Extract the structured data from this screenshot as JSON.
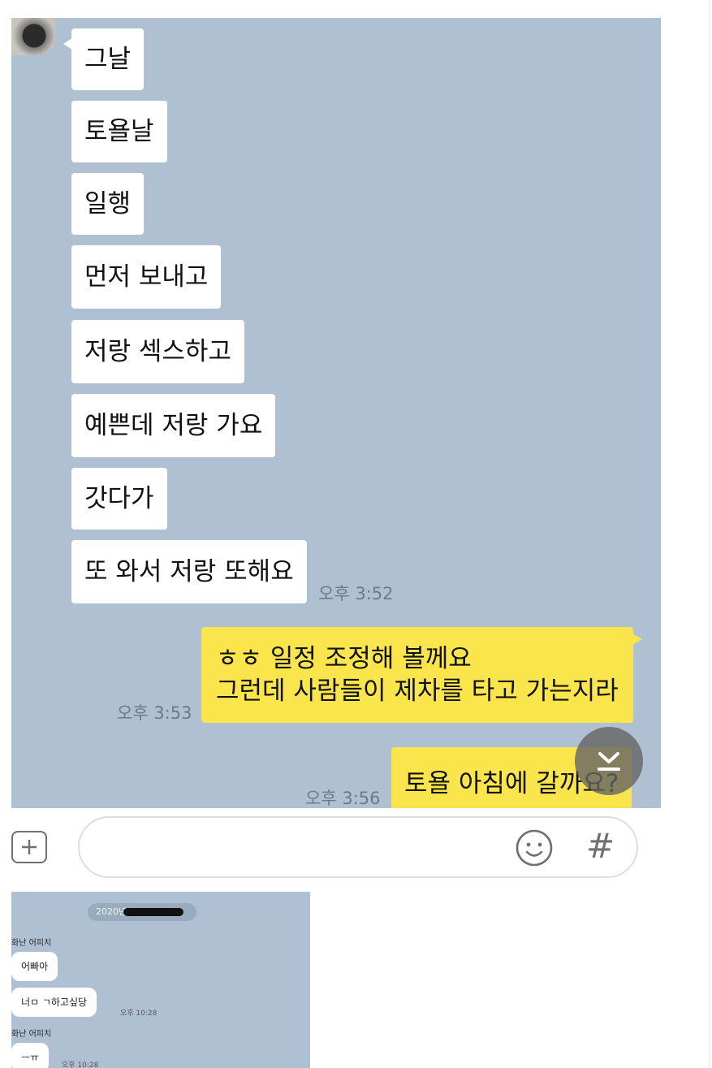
{
  "chat": {
    "received": [
      {
        "text": "그날"
      },
      {
        "text": "토욜날"
      },
      {
        "text": "일행"
      },
      {
        "text": "먼저 보내고"
      },
      {
        "text": "저랑 섹스하고"
      },
      {
        "text": "예쁜데 저랑 가요"
      },
      {
        "text": "갓다가"
      },
      {
        "text": "또 와서 저랑 또해요"
      }
    ],
    "received_time": "오후 3:52",
    "sent": [
      {
        "line1": "ㅎㅎ 일정 조정해 볼께요",
        "line2": "그런데 사람들이 제차를 타고 가는지라",
        "time": "오후 3:53"
      },
      {
        "text": "토욜 아침에 갈까요?",
        "time": "오후 3:56"
      }
    ],
    "colors": {
      "background": "#aec0d2",
      "received_bubble": "#ffffff",
      "sent_bubble": "#fae54d"
    }
  },
  "input_bar": {
    "plus_icon": "plus-icon",
    "emoji_icon": "emoji-icon",
    "hash_label": "#",
    "placeholder": ""
  },
  "thumbnail": {
    "date_text": "2020년",
    "messages": [
      {
        "sender": "화난 어피치",
        "text": "어빠아"
      },
      {
        "text": "너ㅁ ㄱ하고싶당",
        "time": "오후 10:28"
      },
      {
        "sender": "화난 어피치",
        "text": "ㅡㅠ",
        "time": "오후 10:28"
      }
    ]
  }
}
